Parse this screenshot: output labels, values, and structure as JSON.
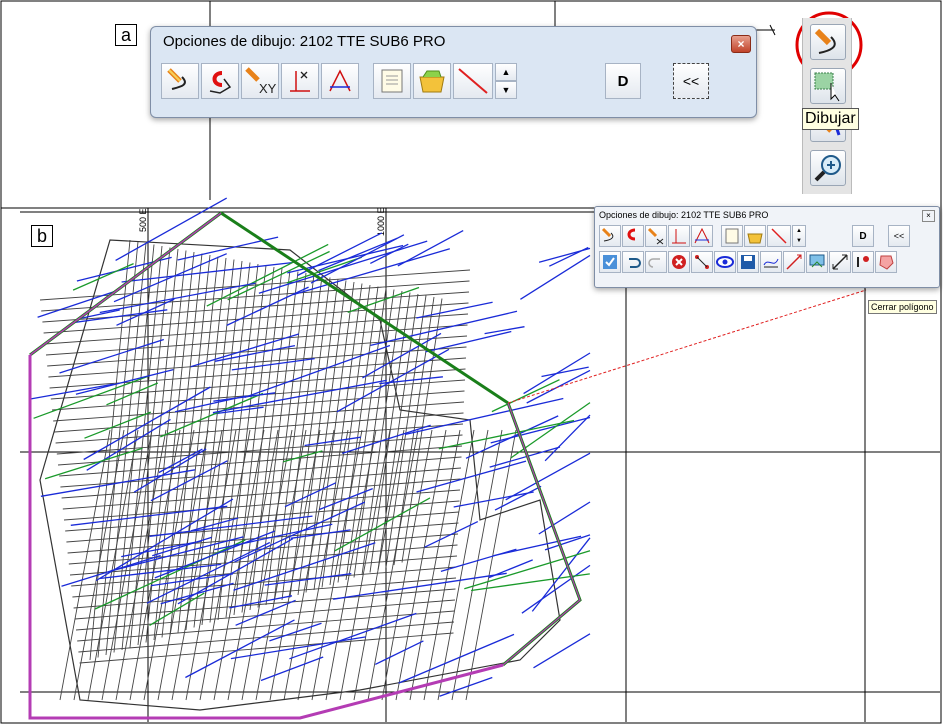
{
  "panel_a": {
    "label": "a",
    "window_title": "Opciones de dibujo: 2102 TTE SUB6 PRO",
    "close_label": "×",
    "d_button": "D",
    "collapse_button": "<<",
    "xy_label": "XY"
  },
  "panel_b": {
    "label": "b",
    "window_title": "Opciones de dibujo: 2102 TTE SUB6 PRO",
    "close_label": "×",
    "d_button": "D",
    "collapse_button": "<<",
    "tooltip": "Cerrar polígono",
    "axis_label_1": "500 E",
    "axis_label_2": "1000 E"
  },
  "right_toolbar": {
    "tooltip": "Dibujar"
  },
  "colors": {
    "highlight_circle": "#e00000",
    "polygon_green": "#1a7f1a",
    "polygon_magenta": "#b43cb4",
    "faults_blue": "#1a2bd8",
    "red_dashed": "#e02020"
  }
}
